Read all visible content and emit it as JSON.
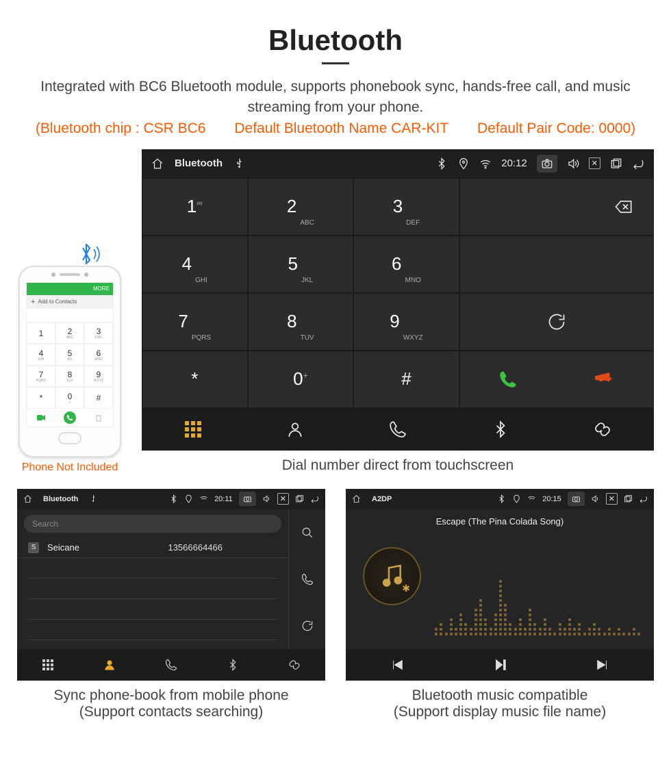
{
  "header": {
    "title": "Bluetooth",
    "desc": "Integrated with BC6 Bluetooth module, supports phonebook sync, hands-free call, and music streaming from your phone.",
    "spec_chip": "(Bluetooth chip : CSR BC6",
    "spec_name": "Default Bluetooth Name CAR-KIT",
    "spec_code": "Default Pair Code: 0000)"
  },
  "phone": {
    "bar": "MORE",
    "add": "Add to Contacts",
    "keys": [
      {
        "n": "1",
        "l": ""
      },
      {
        "n": "2",
        "l": "ABC"
      },
      {
        "n": "3",
        "l": "DEF"
      },
      {
        "n": "4",
        "l": "GHI"
      },
      {
        "n": "5",
        "l": "JKL"
      },
      {
        "n": "6",
        "l": "MNO"
      },
      {
        "n": "7",
        "l": "PQRS"
      },
      {
        "n": "8",
        "l": "TUV"
      },
      {
        "n": "9",
        "l": "WXYZ"
      },
      {
        "n": "*",
        "l": ""
      },
      {
        "n": "0",
        "l": "+"
      },
      {
        "n": "#",
        "l": ""
      }
    ],
    "note": "Phone Not Included"
  },
  "main_unit": {
    "title": "Bluetooth",
    "time": "20:12",
    "keys": [
      {
        "n": "1",
        "l": "∞",
        "sub": ""
      },
      {
        "n": "2",
        "l": "",
        "sub": "ABC"
      },
      {
        "n": "3",
        "l": "",
        "sub": "DEF"
      },
      {
        "n": "4",
        "l": "",
        "sub": "GHI"
      },
      {
        "n": "5",
        "l": "",
        "sub": "JKL"
      },
      {
        "n": "6",
        "l": "",
        "sub": "MNO"
      },
      {
        "n": "7",
        "l": "",
        "sub": "PQRS"
      },
      {
        "n": "8",
        "l": "",
        "sub": "TUV"
      },
      {
        "n": "9",
        "l": "",
        "sub": "WXYZ"
      },
      {
        "n": "*",
        "l": "",
        "sub": ""
      },
      {
        "n": "0",
        "l": "+",
        "sub": ""
      },
      {
        "n": "#",
        "l": "",
        "sub": ""
      }
    ],
    "caption": "Dial number direct from touchscreen"
  },
  "contacts_unit": {
    "title": "Bluetooth",
    "time": "20:11",
    "search": "Search",
    "contact": {
      "badge": "S",
      "name": "Seicane",
      "phone": "13566664466"
    },
    "caption_l1": "Sync phone-book from mobile phone",
    "caption_l2": "(Support contacts searching)"
  },
  "music_unit": {
    "title": "A2DP",
    "time": "20:15",
    "track": "Escape (The Pina Colada Song)",
    "caption_l1": "Bluetooth music compatible",
    "caption_l2": "(Support display music file name)"
  }
}
